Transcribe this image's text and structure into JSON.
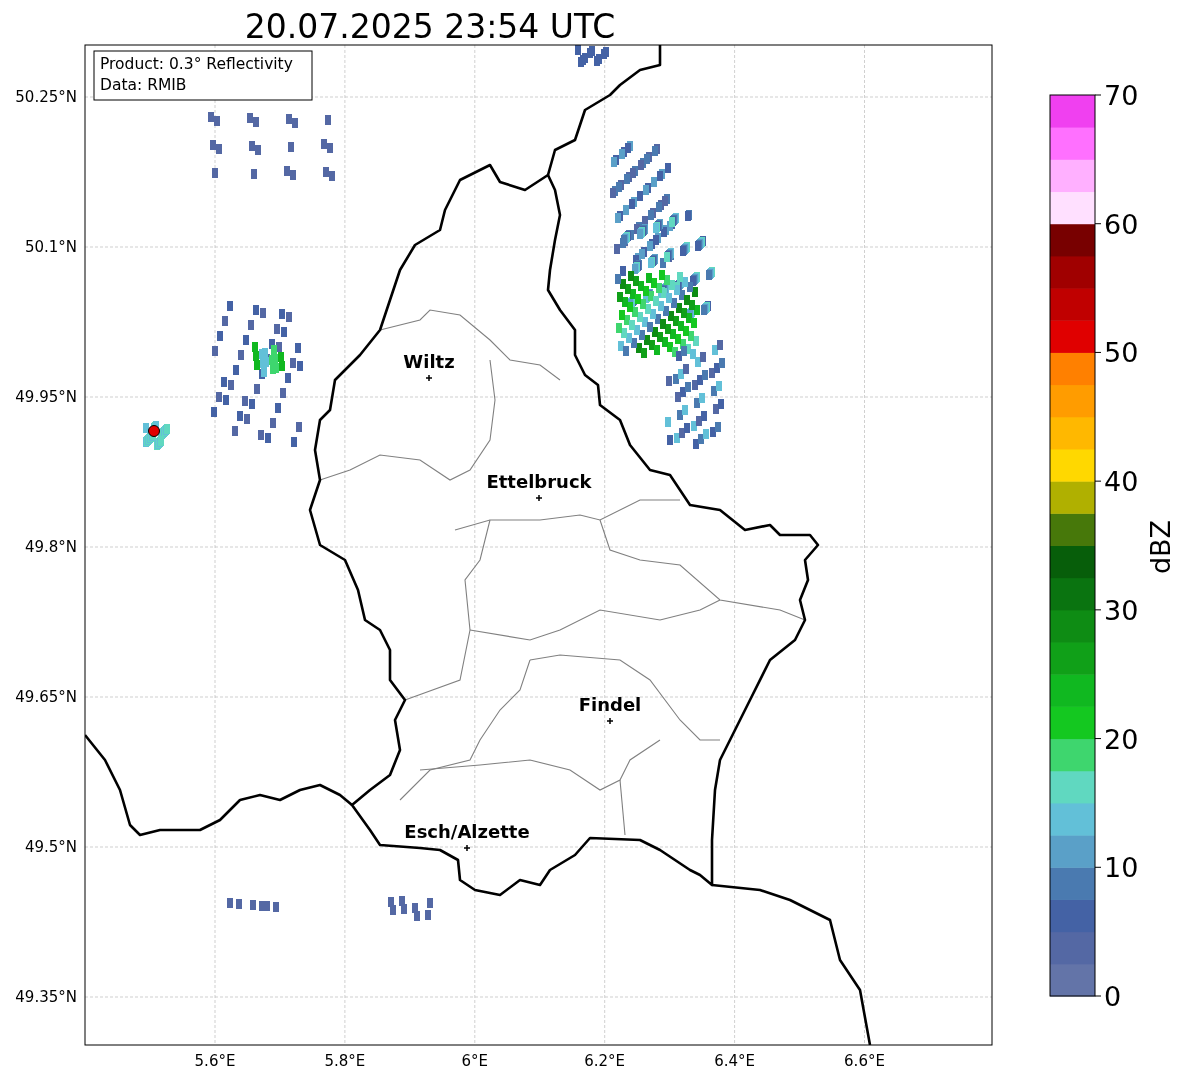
{
  "title": "20.07.2025 23:54 UTC",
  "info": [
    "Product: 0.3° Reflectivity",
    "Data: RMIB"
  ],
  "map": {
    "lat_ticks": [
      "50.25°N",
      "50.1°N",
      "49.95°N",
      "49.8°N",
      "49.65°N",
      "49.5°N",
      "49.35°N"
    ],
    "lon_ticks": [
      "5.6°E",
      "5.8°E",
      "6°E",
      "6.2°E",
      "6.4°E",
      "6.6°E"
    ],
    "cities": [
      {
        "name": "Wiltz"
      },
      {
        "name": "Ettelbruck"
      },
      {
        "name": "Findel"
      },
      {
        "name": "Esch/Alzette"
      }
    ]
  },
  "colorbar": {
    "label": "dBZ",
    "ticks": [
      "70",
      "60",
      "50",
      "40",
      "30",
      "20",
      "10",
      "0"
    ],
    "segments": [
      {
        "color": "#6374a8"
      },
      {
        "color": "#5468a4"
      },
      {
        "color": "#4462a5"
      },
      {
        "color": "#4a7ab0"
      },
      {
        "color": "#5aa0c8"
      },
      {
        "color": "#62c0d8"
      },
      {
        "color": "#60d8c0"
      },
      {
        "color": "#3ed66e"
      },
      {
        "color": "#14c820"
      },
      {
        "color": "#10b820"
      },
      {
        "color": "#10a018"
      },
      {
        "color": "#0e8c14"
      },
      {
        "color": "#0a7410"
      },
      {
        "color": "#075e0a"
      },
      {
        "color": "#47780a"
      },
      {
        "color": "#b0b000"
      },
      {
        "color": "#ffd800"
      },
      {
        "color": "#ffb800"
      },
      {
        "color": "#ff9c00"
      },
      {
        "color": "#ff8000"
      },
      {
        "color": "#e00000"
      },
      {
        "color": "#c00000"
      },
      {
        "color": "#a00000"
      },
      {
        "color": "#780000"
      },
      {
        "color": "#ffe0ff"
      },
      {
        "color": "#ffb0ff"
      },
      {
        "color": "#ff70ff"
      },
      {
        "color": "#f040f0"
      }
    ]
  }
}
